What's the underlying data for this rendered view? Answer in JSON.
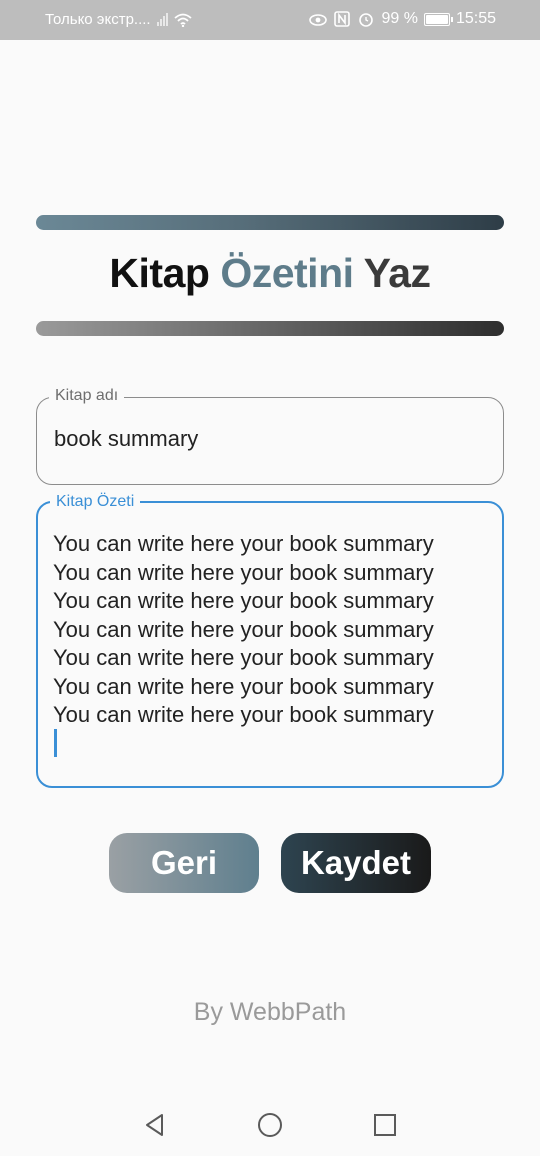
{
  "status_bar": {
    "carrier_text": "Только экстр....",
    "battery_percent": "99 %",
    "time": "15:55",
    "icons": [
      "signal-icon",
      "wifi-icon",
      "eye-icon",
      "nfc-icon",
      "alarm-icon",
      "battery-icon"
    ]
  },
  "header": {
    "title_part1": "Kitap",
    "title_part2": "Özetini",
    "title_part3": "Yaz",
    "colors": {
      "part1": "#111111",
      "part2": "#5e7c8a",
      "part3": "#3a3a3a"
    }
  },
  "form": {
    "book_name": {
      "label": "Kitap adı",
      "value": "book summary"
    },
    "book_summary": {
      "label": "Kitap Özeti",
      "lines": [
        "You can write here your book summary",
        "You can write here your book summary",
        "You can write here your book summary",
        "You can write here your book summary",
        "You can write here your book summary",
        "You can write here your book summary",
        "You can write here your book summary"
      ],
      "focus_color": "#3a8fd6"
    }
  },
  "buttons": {
    "back_label": "Geri",
    "save_label": "Kaydet"
  },
  "footer": {
    "text": "By WebbPath"
  },
  "nav_bar": {
    "icons": [
      "back-icon",
      "home-icon",
      "recents-icon"
    ]
  }
}
